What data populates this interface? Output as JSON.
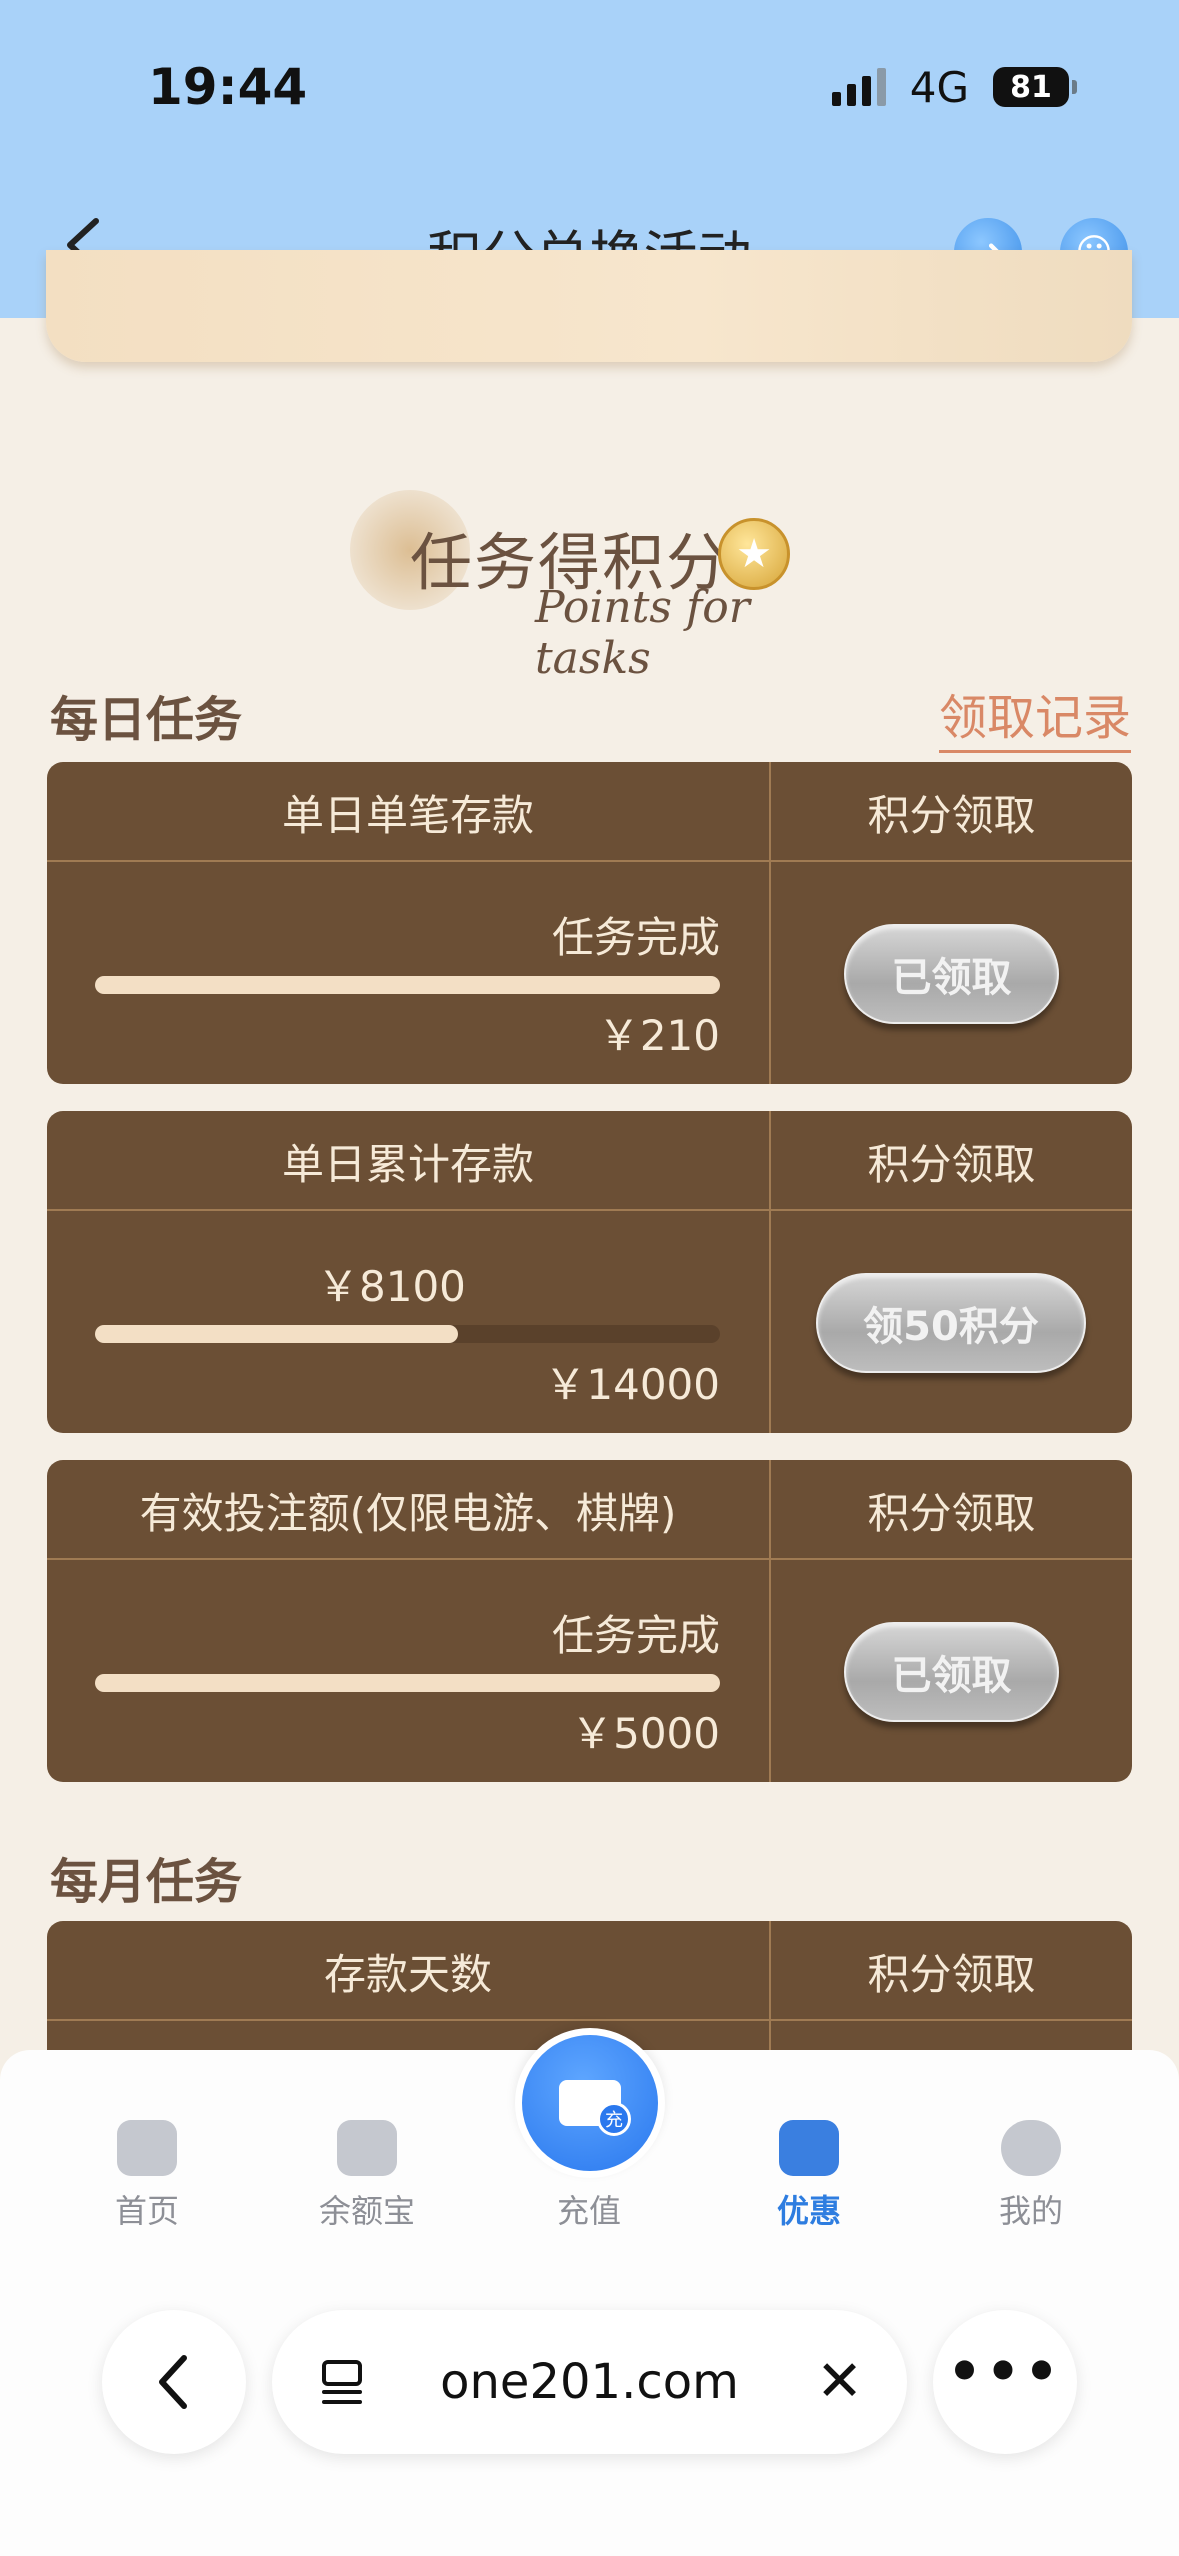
{
  "status_bar": {
    "time": "19:44",
    "network": "4G",
    "battery": "81"
  },
  "header": {
    "title": "积分兑换活动"
  },
  "hero": {
    "title": "任务得积分",
    "subtitle": "Points for tasks"
  },
  "daily": {
    "title": "每日任务",
    "records_link": "领取记录",
    "tasks": [
      {
        "name": "单日单笔存款",
        "claim_header": "积分领取",
        "progress_text": "任务完成",
        "progress": 1.0,
        "target": "￥210",
        "button": "已领取"
      },
      {
        "name": "单日累计存款",
        "claim_header": "积分领取",
        "progress_text": "￥8100",
        "progress": 0.58,
        "target": "￥14000",
        "button": "领50积分"
      },
      {
        "name": "有效投注额(仅限电游、棋牌)",
        "claim_header": "积分领取",
        "progress_text": "任务完成",
        "progress": 1.0,
        "target": "￥5000",
        "button": "已领取"
      }
    ]
  },
  "monthly": {
    "title": "每月任务",
    "tasks": [
      {
        "name": "存款天数",
        "claim_header": "积分领取"
      }
    ]
  },
  "bottom_nav": [
    {
      "label": "首页",
      "icon": "home-icon"
    },
    {
      "label": "余额宝",
      "icon": "wallet-icon"
    },
    {
      "label": "充值",
      "icon": "recharge-icon"
    },
    {
      "label": "优惠",
      "icon": "promo-icon",
      "active": true
    },
    {
      "label": "我的",
      "icon": "user-icon"
    }
  ],
  "browser": {
    "url": "one201.com"
  }
}
